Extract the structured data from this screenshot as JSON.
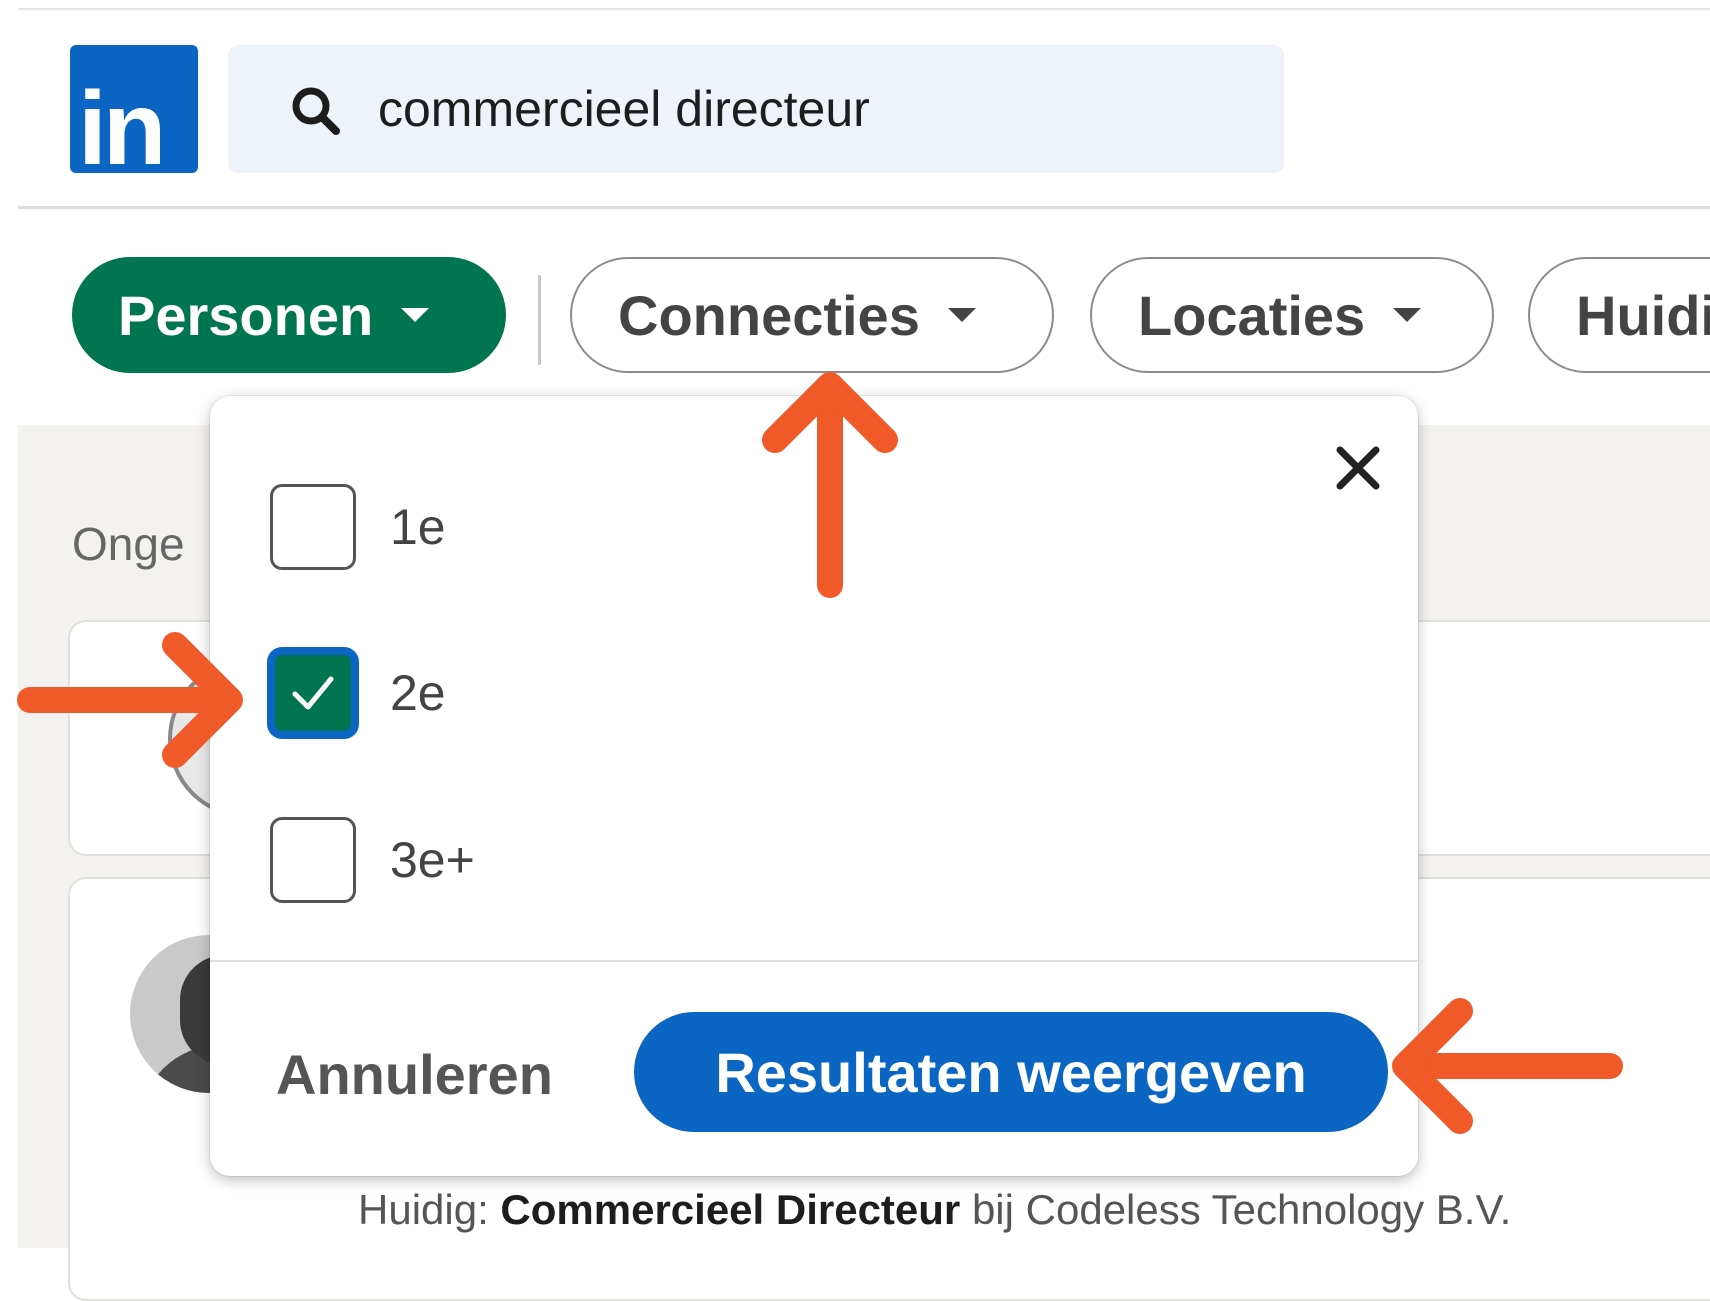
{
  "header": {
    "logo_text": "in",
    "search_value": "commercieel directeur"
  },
  "filters": [
    {
      "label": "Personen"
    },
    {
      "label": "Connecties"
    },
    {
      "label": "Locaties"
    },
    {
      "label": "Huidi"
    }
  ],
  "results": {
    "partial_heading": "Onge",
    "result_line": {
      "prefix": "Huidig: ",
      "title": "Commercieel Directeur",
      "suffix": " bij Codeless Technology B.V."
    }
  },
  "connections_dropdown": {
    "close_icon": "close-icon",
    "options": [
      {
        "label": "1e",
        "checked": false
      },
      {
        "label": "2e",
        "checked": true
      },
      {
        "label": "3e+",
        "checked": false
      }
    ],
    "cancel_label": "Annuleren",
    "submit_label": "Resultaten weergeven"
  },
  "colors": {
    "brand_blue": "#0a66c2",
    "active_green": "#01754f",
    "annotation_orange": "#f05a28"
  }
}
